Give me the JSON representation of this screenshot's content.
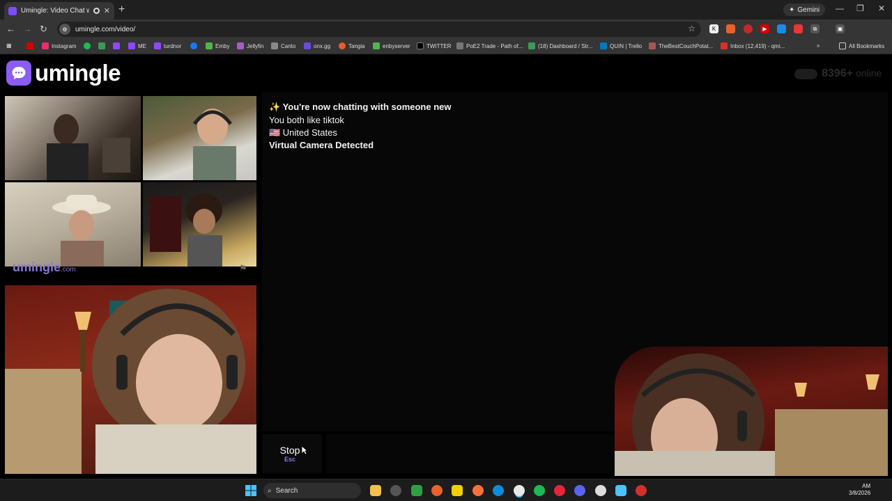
{
  "browser": {
    "tab_title": "Umingle: Video Chat with S",
    "tab_close": "✕",
    "new_tab": "+",
    "gemini_label": "Gemini",
    "url": "umingle.com/video/",
    "bookmarks": [
      {
        "label": "Instagram",
        "color": "#e1306c"
      },
      {
        "label": "",
        "color": "#1db954"
      },
      {
        "label": "ME",
        "color": "#7b4dff"
      },
      {
        "label": "turdnor",
        "color": "#7b4dff"
      },
      {
        "label": "Emby",
        "color": "#52b54b"
      },
      {
        "label": "Jellyfin",
        "color": "#aa5cc3"
      },
      {
        "label": "Canto",
        "color": "#888888"
      },
      {
        "label": "onx.gg",
        "color": "#6b4bd8"
      },
      {
        "label": "Tangia",
        "color": "#f05a28"
      },
      {
        "label": "enbyserver",
        "color": "#52b54b"
      },
      {
        "label": "TWITTER",
        "color": "#000000"
      },
      {
        "label": "PoE2 Trade - Path of...",
        "color": "#777777"
      },
      {
        "label": "(18) Dashboard / Str...",
        "color": "#3b9a5a"
      },
      {
        "label": "QUIN | Trello",
        "color": "#0079bf"
      },
      {
        "label": "TheBestCouchPotat...",
        "color": "#a55"
      },
      {
        "label": "Inbox (12,419) - qmi...",
        "color": "#d93025"
      }
    ],
    "all_bookmarks": "All Bookmarks"
  },
  "page": {
    "logo_text": "umingle",
    "online_count": "8396+",
    "online_label": "online",
    "ad_watermark": "umingle",
    "ad_watermark_suffix": ".com",
    "chat_messages": [
      {
        "text": "✨ You're now chatting with someone new",
        "bold": true
      },
      {
        "text": "You both like tiktok",
        "bold": false
      },
      {
        "text": "🇺🇸 United States",
        "bold": false
      },
      {
        "text": "Virtual Camera Detected",
        "bold": true
      }
    ],
    "stop_label": "Stop",
    "stop_shortcut": "Esc"
  },
  "taskbar": {
    "search_label": "Search",
    "time": "AM",
    "date": "3/8/2026"
  },
  "colors": {
    "accent": "#8b5cf6",
    "chat_bg": "#070707",
    "page_bg": "#000000"
  }
}
